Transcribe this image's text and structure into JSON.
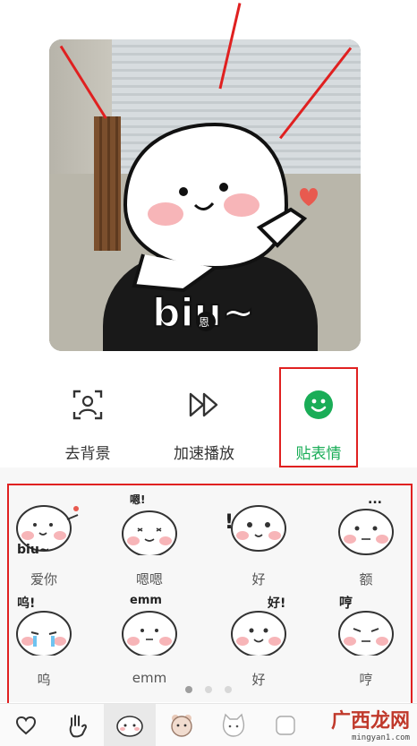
{
  "preview": {
    "sticker_text": "biu~",
    "badge_text": "恩"
  },
  "actions": [
    {
      "label": "去背景",
      "icon": "person-frame-icon"
    },
    {
      "label": "加速播放",
      "icon": "fast-forward-icon"
    },
    {
      "label": "贴表情",
      "icon": "smiley-icon"
    }
  ],
  "stickers": [
    {
      "caption": "爱你",
      "overlay": "biu~"
    },
    {
      "caption": "嗯嗯",
      "overlay": "嗯!"
    },
    {
      "caption": "好",
      "overlay": "!"
    },
    {
      "caption": "额",
      "overlay": "..."
    },
    {
      "caption": "呜",
      "overlay": "呜!"
    },
    {
      "caption": "emm",
      "overlay": "emm"
    },
    {
      "caption": "好",
      "overlay": "好!"
    },
    {
      "caption": "哼",
      "overlay": "哼"
    }
  ],
  "pager": {
    "pages": 3,
    "current": 1
  },
  "tray": [
    {
      "icon": "heart-icon"
    },
    {
      "icon": "hand-gesture-icon"
    },
    {
      "icon": "bun-face-icon"
    },
    {
      "icon": "bear-face-icon"
    },
    {
      "icon": "cat-face-icon"
    },
    {
      "icon": "sticker-pack-icon"
    }
  ],
  "watermark": {
    "title": "广西龙网",
    "url": "mingyan1.com"
  },
  "colors": {
    "accent": "#1aad57",
    "highlight": "#e02020",
    "blush": "#f7b5b8"
  }
}
